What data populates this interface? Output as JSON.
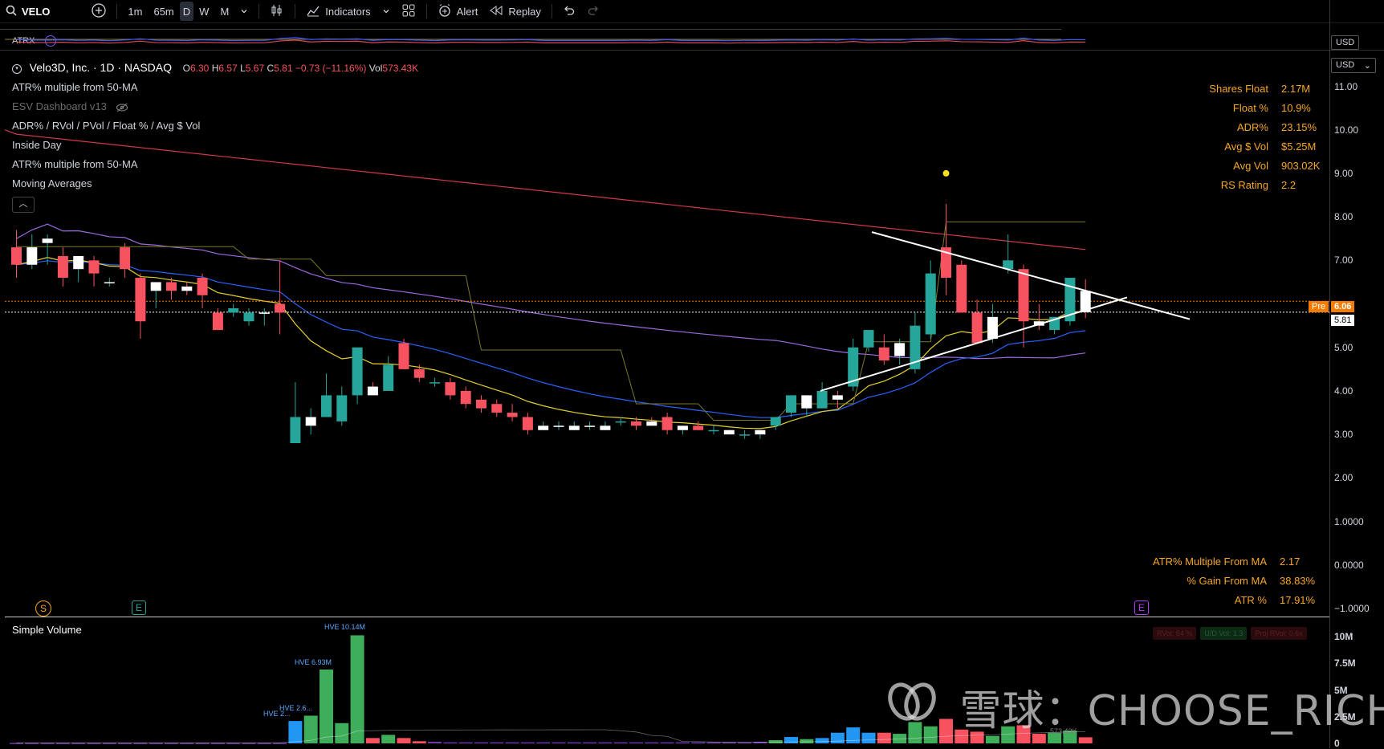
{
  "toolbar": {
    "symbol": "VELO",
    "intervals": [
      "1m",
      "65m",
      "D",
      "W",
      "M"
    ],
    "active_interval": "D",
    "indicators_label": "Indicators",
    "alert_label": "Alert",
    "replay_label": "Replay"
  },
  "atrx_label": "ATRX",
  "currency": "USD",
  "legend": {
    "title": "Velo3D, Inc. · 1D · NASDAQ",
    "open_key": "O",
    "open": "6.30",
    "high_key": "H",
    "high": "6.57",
    "low_key": "L",
    "low": "5.67",
    "close_key": "C",
    "close": "5.81",
    "change": "−0.73 (−11.16%)",
    "vol_key": "Vol",
    "vol": "573.43K",
    "indicators": [
      "ATR% multiple from 50-MA",
      "ESV Dashboard v13",
      "ADR% / RVol / PVol / Float % / Avg $ Vol",
      "Inside Day",
      "ATR% multiple from 50-MA",
      "Moving Averages"
    ]
  },
  "stats_table": [
    {
      "label": "Shares Float",
      "value": "2.17M"
    },
    {
      "label": "Float %",
      "value": "10.9%"
    },
    {
      "label": "ADR%",
      "value": "23.15%"
    },
    {
      "label": "Avg $ Vol",
      "value": "$5.25M"
    },
    {
      "label": "Avg Vol",
      "value": "903.02K"
    },
    {
      "label": "RS Rating",
      "value": "2.2"
    }
  ],
  "atr_table": [
    {
      "label": "ATR% Multiple From MA",
      "value": "2.17"
    },
    {
      "label": "% Gain From MA",
      "value": "38.83%"
    },
    {
      "label": "ATR %",
      "value": "17.91%"
    }
  ],
  "price_axis": {
    "ticks": [
      "11.00",
      "10.00",
      "9.00",
      "8.00",
      "7.00",
      "5.00",
      "4.00",
      "3.00",
      "2.00",
      "1.0000",
      "0.0000",
      "−1.0000"
    ],
    "tick_values": [
      11,
      10,
      9,
      8,
      7,
      5,
      4,
      3,
      2,
      1,
      0,
      -1
    ],
    "pre_label": "Pre",
    "pre_value": "6.06",
    "last_value": "5.81"
  },
  "volume_axis": {
    "ticks": [
      "10M",
      "7.5M",
      "5M",
      "2.5M",
      "0"
    ]
  },
  "volume_panel": {
    "title": "Simple Volume",
    "hve_labels": [
      "HVE 10.14M",
      "HVE 6.93M",
      "HVE 2.6...",
      "HVE 2..."
    ],
    "last_vol": "573.43K",
    "badges": [
      "RVol: 64 %",
      "U/D Vol: 1.3",
      "Proj RVol: 0.6x"
    ]
  },
  "event_icons": {
    "s": "S",
    "e": "E"
  },
  "watermark": "雪球：CHOOSE_RICH",
  "colors": {
    "up": "#26a69a",
    "down": "#f7525f",
    "accent": "#f5a623",
    "ma200": "#d1394b",
    "ma50": "#9c6ade",
    "ema": "#2962ff",
    "ema10": "#e5d02a"
  },
  "chart_data": {
    "type": "candlestick",
    "ylim": [
      -1,
      11.6
    ],
    "candles": [
      [
        7.3,
        7.7,
        6.6,
        6.9
      ],
      [
        6.9,
        7.6,
        6.8,
        7.3
      ],
      [
        7.4,
        7.6,
        6.9,
        7.5
      ],
      [
        7.1,
        7.3,
        6.4,
        6.6
      ],
      [
        6.8,
        7.0,
        6.5,
        7.1
      ],
      [
        7.0,
        7.1,
        6.4,
        6.7
      ],
      [
        6.5,
        6.6,
        6.4,
        6.5
      ],
      [
        7.3,
        7.4,
        6.6,
        6.8
      ],
      [
        6.6,
        6.7,
        5.2,
        5.6
      ],
      [
        6.3,
        6.5,
        5.9,
        6.5
      ],
      [
        6.5,
        6.6,
        6.1,
        6.3
      ],
      [
        6.4,
        6.5,
        6.2,
        6.3
      ],
      [
        6.6,
        6.7,
        5.9,
        6.2
      ],
      [
        5.8,
        5.9,
        5.4,
        5.4
      ],
      [
        5.8,
        6.0,
        5.7,
        5.9
      ],
      [
        5.6,
        5.9,
        5.5,
        5.8
      ],
      [
        5.8,
        5.9,
        5.5,
        5.8
      ],
      [
        6.0,
        7.0,
        5.3,
        5.8
      ],
      [
        2.8,
        4.2,
        2.8,
        3.4
      ],
      [
        3.2,
        3.6,
        3.0,
        3.4
      ],
      [
        3.4,
        4.4,
        3.4,
        3.9
      ],
      [
        3.3,
        4.1,
        3.2,
        3.9
      ],
      [
        3.9,
        5.0,
        3.7,
        5.0
      ],
      [
        4.1,
        4.2,
        3.9,
        3.9
      ],
      [
        4.0,
        4.8,
        4.0,
        4.6
      ],
      [
        5.1,
        5.2,
        4.5,
        4.5
      ],
      [
        4.5,
        4.6,
        4.2,
        4.3
      ],
      [
        4.2,
        4.3,
        4.1,
        4.2
      ],
      [
        4.2,
        4.3,
        3.8,
        3.9
      ],
      [
        4.0,
        4.1,
        3.6,
        3.7
      ],
      [
        3.8,
        3.9,
        3.5,
        3.6
      ],
      [
        3.7,
        3.8,
        3.4,
        3.5
      ],
      [
        3.5,
        3.7,
        3.3,
        3.4
      ],
      [
        3.4,
        3.5,
        3.0,
        3.1
      ],
      [
        3.1,
        3.3,
        3.1,
        3.2
      ],
      [
        3.2,
        3.3,
        3.1,
        3.2
      ],
      [
        3.1,
        3.3,
        3.1,
        3.2
      ],
      [
        3.2,
        3.3,
        3.1,
        3.2
      ],
      [
        3.1,
        3.3,
        3.1,
        3.2
      ],
      [
        3.3,
        3.4,
        3.2,
        3.3
      ],
      [
        3.3,
        3.4,
        3.1,
        3.2
      ],
      [
        3.3,
        3.4,
        3.2,
        3.2
      ],
      [
        3.4,
        3.5,
        3.0,
        3.1
      ],
      [
        3.1,
        3.2,
        3.0,
        3.2
      ],
      [
        3.2,
        3.3,
        3.1,
        3.1
      ],
      [
        3.1,
        3.2,
        3.0,
        3.1
      ],
      [
        3.1,
        3.1,
        3.0,
        3.0
      ],
      [
        3.0,
        3.1,
        2.9,
        3.0
      ],
      [
        3.0,
        3.1,
        2.9,
        3.1
      ],
      [
        3.2,
        3.4,
        3.1,
        3.4
      ],
      [
        3.5,
        3.9,
        3.4,
        3.9
      ],
      [
        3.6,
        3.8,
        3.4,
        3.9
      ],
      [
        3.6,
        4.2,
        3.6,
        4.0
      ],
      [
        3.9,
        4.0,
        3.6,
        3.8
      ],
      [
        4.1,
        5.2,
        4.0,
        5.0
      ],
      [
        5.0,
        5.4,
        4.9,
        5.4
      ],
      [
        5.0,
        5.3,
        4.6,
        4.7
      ],
      [
        4.8,
        5.2,
        4.6,
        5.1
      ],
      [
        4.5,
        5.8,
        4.4,
        5.5
      ],
      [
        5.3,
        7.0,
        5.2,
        6.7
      ],
      [
        7.3,
        8.3,
        6.2,
        6.6
      ],
      [
        6.9,
        7.0,
        5.8,
        5.8
      ],
      [
        5.8,
        6.1,
        5.1,
        5.1
      ],
      [
        5.2,
        6.0,
        5.1,
        5.7
      ],
      [
        6.8,
        7.6,
        6.7,
        7.0
      ],
      [
        6.8,
        6.9,
        5.0,
        5.6
      ],
      [
        5.6,
        6.0,
        5.4,
        5.5
      ],
      [
        5.4,
        5.7,
        5.3,
        5.7
      ],
      [
        5.6,
        6.6,
        5.5,
        6.6
      ],
      [
        6.3,
        6.57,
        5.67,
        5.81
      ]
    ],
    "volumes": [
      0.05,
      0.05,
      0.05,
      0.05,
      0.05,
      0.05,
      0.05,
      0.05,
      0.05,
      0.05,
      0.05,
      0.05,
      0.05,
      0.05,
      0.05,
      0.05,
      0.05,
      0.05,
      2.1,
      2.6,
      6.93,
      1.9,
      10.14,
      0.5,
      0.8,
      0.5,
      0.2,
      0.15,
      0.1,
      0.1,
      0.1,
      0.1,
      0.1,
      0.1,
      0.1,
      0.1,
      0.1,
      0.1,
      0.1,
      0.1,
      0.1,
      0.1,
      0.1,
      0.1,
      0.1,
      0.1,
      0.1,
      0.1,
      0.15,
      0.3,
      0.6,
      0.4,
      0.5,
      1.0,
      1.5,
      1.0,
      1.0,
      0.9,
      2.0,
      1.6,
      2.3,
      1.3,
      1.1,
      0.7,
      1.6,
      1.7,
      0.9,
      1.0,
      1.2,
      0.57
    ]
  }
}
